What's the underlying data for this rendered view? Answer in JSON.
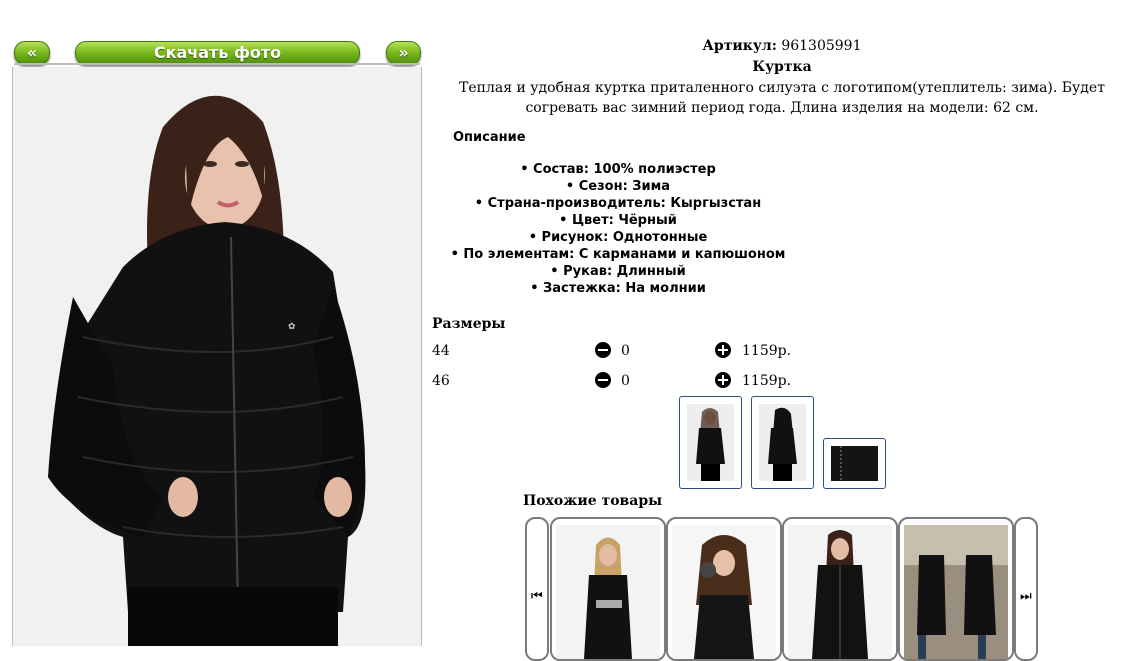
{
  "nav": {
    "prev_label": "«",
    "download_label": "Скачать фото",
    "next_label": "»"
  },
  "product": {
    "article_label": "Артикул:",
    "article_value": "961305991",
    "name": "Куртка",
    "description": "Теплая и удобная куртка приталенного силуэта с логотипом(утеплитель: зима). Будет согревать вас зимний период года. Длина изделия на модели: 62 см.",
    "description_heading": "Описание",
    "features": [
      "• Состав: 100% полиэстер",
      "• Сезон: Зима",
      "• Страна-производитель: Кыргызстан",
      "• Цвет: Чёрный",
      "• Рисунок: Однотонные",
      "• По элементам: С карманами и капюшоном",
      "• Рукав: Длинный",
      "• Застежка: На молнии"
    ]
  },
  "sizes": {
    "heading": "Размеры",
    "rows": [
      {
        "size": "44",
        "qty": "0",
        "price": "1159р."
      },
      {
        "size": "46",
        "qty": "0",
        "price": "1159р."
      }
    ]
  },
  "similar": {
    "heading": "Похожие товары"
  },
  "colors": {
    "accent_green": "#7cbb1e",
    "thumb_border": "#2a4f7a"
  }
}
